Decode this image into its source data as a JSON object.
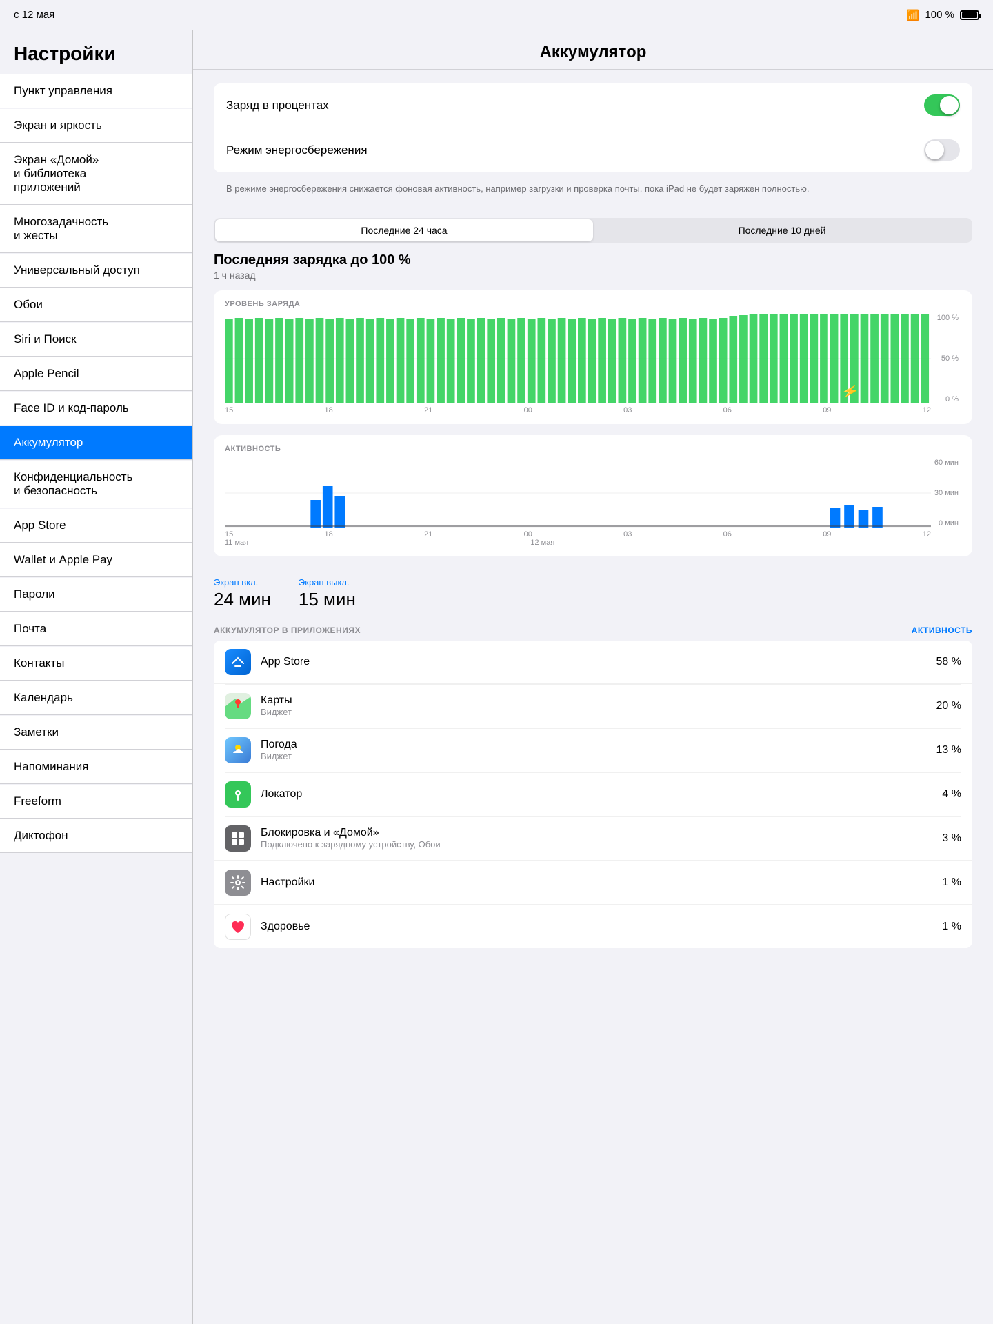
{
  "statusBar": {
    "date": "с 12 мая",
    "wifi": "📶",
    "battery": "100 %"
  },
  "sidebar": {
    "title": "Настройки",
    "items": [
      {
        "id": "control-center",
        "label": "Пункт управления"
      },
      {
        "id": "display",
        "label": "Экран и яркость"
      },
      {
        "id": "home-screen",
        "label": "Экран «Домой»\nи библиотека\nприложений"
      },
      {
        "id": "multitasking",
        "label": "Многозадачность\nи жесты"
      },
      {
        "id": "accessibility",
        "label": "Универсальный доступ"
      },
      {
        "id": "wallpaper",
        "label": "Обои"
      },
      {
        "id": "siri",
        "label": "Siri и Поиск"
      },
      {
        "id": "apple-pencil",
        "label": "Apple Pencil"
      },
      {
        "id": "face-id",
        "label": "Face ID и код-пароль"
      },
      {
        "id": "battery",
        "label": "Аккумулятор",
        "active": true
      },
      {
        "id": "privacy",
        "label": "Конфиденциальность\nи безопасность"
      },
      {
        "id": "app-store",
        "label": "App Store"
      },
      {
        "id": "wallet",
        "label": "Wallet и Apple Pay"
      },
      {
        "id": "passwords",
        "label": "Пароли"
      },
      {
        "id": "mail",
        "label": "Почта"
      },
      {
        "id": "contacts",
        "label": "Контакты"
      },
      {
        "id": "calendar",
        "label": "Календарь"
      },
      {
        "id": "notes",
        "label": "Заметки"
      },
      {
        "id": "reminders",
        "label": "Напоминания"
      },
      {
        "id": "freeform",
        "label": "Freeform"
      },
      {
        "id": "voice-memos",
        "label": "Диктофон"
      }
    ]
  },
  "main": {
    "title": "Аккумулятор",
    "settings": {
      "chargePercent": {
        "label": "Заряд в процентах",
        "value": true
      },
      "powerSaving": {
        "label": "Режим энергосбережения",
        "value": false
      },
      "description": "В режиме энергосбережения снижается фоновая активность, например загрузки и проверка почты, пока iPad не будет заряжен полностью."
    },
    "tabs": [
      {
        "id": "24h",
        "label": "Последние 24 часа",
        "active": true
      },
      {
        "id": "10d",
        "label": "Последние 10 дней",
        "active": false
      }
    ],
    "lastCharge": {
      "title": "Последняя зарядка до 100 %",
      "subtitle": "1 ч назад"
    },
    "chargeChart": {
      "label": "УРОВЕНЬ ЗАРЯДА",
      "yLabels": [
        "100 %",
        "50 %",
        "0 %"
      ],
      "xLabels": [
        "15",
        "18",
        "21",
        "00",
        "03",
        "06",
        "09",
        "12"
      ]
    },
    "activityChart": {
      "label": "АКТИВНОСТЬ",
      "yLabels": [
        "60 мин",
        "30 мин",
        "0 мин"
      ],
      "xLabels": [
        "15",
        "18",
        "21",
        "00",
        "03",
        "06",
        "09",
        "12"
      ],
      "dateLabels": [
        "11 мая",
        "",
        "",
        "12 мая",
        "",
        "",
        "",
        ""
      ]
    },
    "screenStats": {
      "screenOn": {
        "label": "Экран вкл.",
        "value": "24 мин"
      },
      "screenOff": {
        "label": "Экран выкл.",
        "value": "15 мин"
      }
    },
    "appsSection": {
      "label": "АККУМУЛЯТОР В ПРИЛОЖЕНИЯХ",
      "actionLabel": "АКТИВНОСТЬ",
      "apps": [
        {
          "id": "app-store",
          "name": "App Store",
          "detail": "",
          "percent": "58 %",
          "iconBg": "#0075ff",
          "iconText": "🅐"
        },
        {
          "id": "maps",
          "name": "Карты",
          "detail": "Виджет",
          "percent": "20 %",
          "iconBg": "#00c7be",
          "iconText": "🗺"
        },
        {
          "id": "weather",
          "name": "Погода",
          "detail": "Виджет",
          "percent": "13 %",
          "iconBg": "#5ac8fa",
          "iconText": "🌤"
        },
        {
          "id": "find-my",
          "name": "Локатор",
          "detail": "",
          "percent": "4 %",
          "iconBg": "#34c759",
          "iconText": "📍"
        },
        {
          "id": "lock-home",
          "name": "Блокировка и «Домой»",
          "detail": "Подключено к зарядному устройству, Обои",
          "percent": "3 %",
          "iconBg": "#636366",
          "iconText": "⊞"
        },
        {
          "id": "settings",
          "name": "Настройки",
          "detail": "",
          "percent": "1 %",
          "iconBg": "#636366",
          "iconText": "⚙"
        },
        {
          "id": "health",
          "name": "Здоровье",
          "detail": "",
          "percent": "1 %",
          "iconBg": "#ff375f",
          "iconText": "❤"
        }
      ]
    }
  }
}
